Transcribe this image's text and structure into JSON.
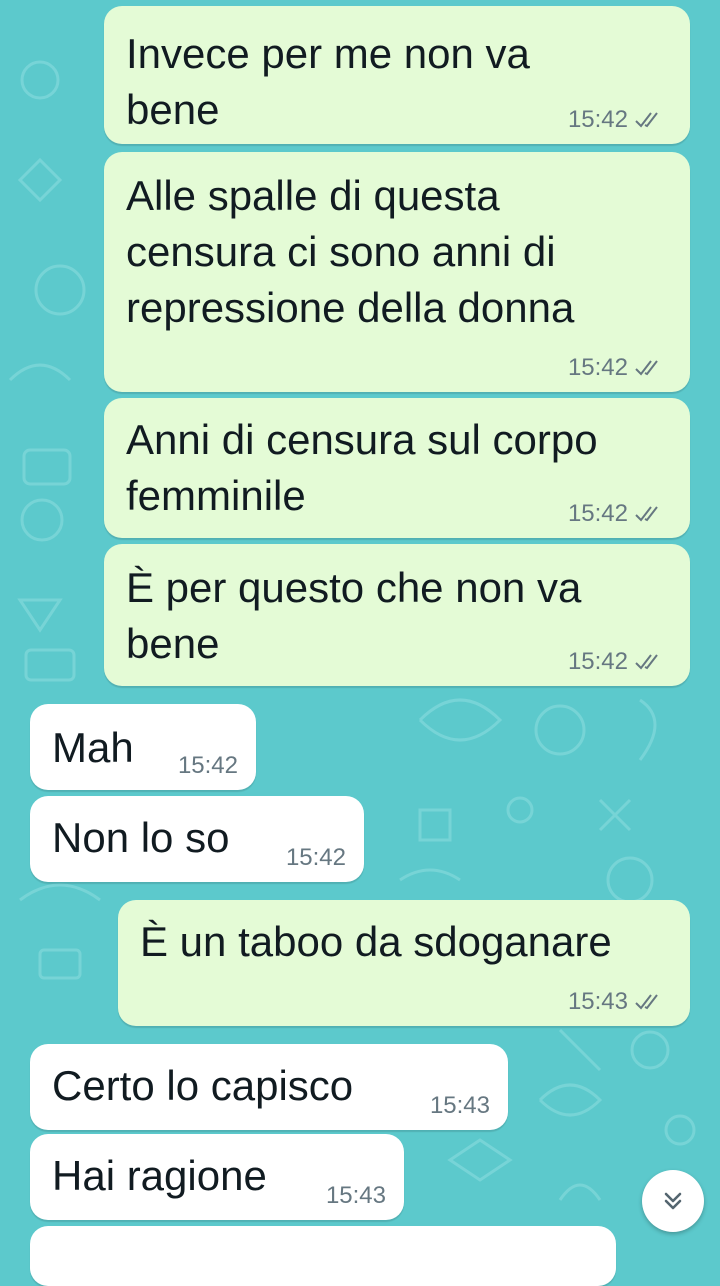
{
  "messages": [
    {
      "id": "m1",
      "side": "out",
      "text": "Invece per me non va\nbene",
      "time": "15:42",
      "status": "read"
    },
    {
      "id": "m2",
      "side": "out",
      "text": "Alle spalle di questa\ncensura ci sono anni di\nrepressione della donna",
      "time": "15:42",
      "status": "read"
    },
    {
      "id": "m3",
      "side": "out",
      "text": "Anni di censura sul corpo\nfemminile",
      "time": "15:42",
      "status": "read"
    },
    {
      "id": "m4",
      "side": "out",
      "text": "È per questo che non va\nbene",
      "time": "15:42",
      "status": "read"
    },
    {
      "id": "m5",
      "side": "in",
      "text": "Mah",
      "time": "15:42"
    },
    {
      "id": "m6",
      "side": "in",
      "text": "Non lo so",
      "time": "15:42"
    },
    {
      "id": "m7",
      "side": "out",
      "text": "È un taboo da sdoganare",
      "time": "15:43",
      "status": "read"
    },
    {
      "id": "m8",
      "side": "in",
      "text": "Certo lo capisco",
      "time": "15:43"
    },
    {
      "id": "m9",
      "side": "in",
      "text": "Hai ragione",
      "time": "15:43"
    }
  ],
  "scroll_button": {
    "icon": "double-chevron-down-icon"
  },
  "colors": {
    "wallpaper": "#5cc9cc",
    "outgoing_bubble": "#e4fbd6",
    "incoming_bubble": "#ffffff",
    "text": "#111b21",
    "meta": "#667781",
    "read_ticks": "#667781"
  }
}
